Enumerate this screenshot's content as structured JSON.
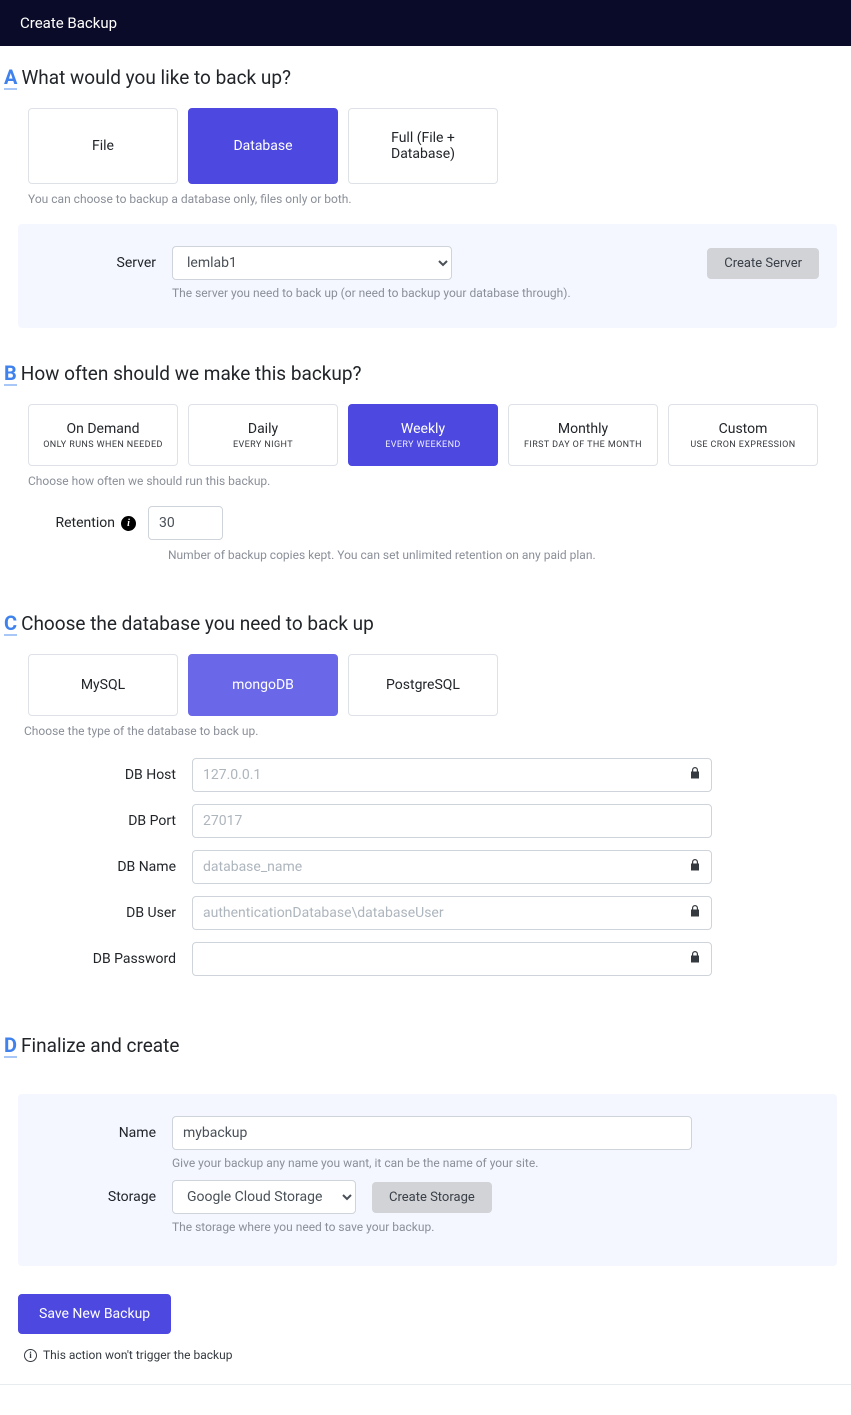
{
  "header": {
    "title": "Create Backup"
  },
  "sectionA": {
    "letter": "A",
    "title": "What would you like to back up?",
    "options": [
      {
        "label": "File"
      },
      {
        "label": "Database"
      },
      {
        "label": "Full (File + Database)"
      }
    ],
    "helper": "You can choose to backup a database only, files only or both.",
    "server": {
      "label": "Server",
      "value": "lemlab1",
      "button": "Create Server",
      "helper": "The server you need to back up (or need to backup your database through)."
    }
  },
  "sectionB": {
    "letter": "B",
    "title": "How often should we make this backup?",
    "options": [
      {
        "title": "On Demand",
        "sub": "ONLY RUNS WHEN NEEDED"
      },
      {
        "title": "Daily",
        "sub": "EVERY NIGHT"
      },
      {
        "title": "Weekly",
        "sub": "EVERY WEEKEND"
      },
      {
        "title": "Monthly",
        "sub": "FIRST DAY OF THE MONTH"
      },
      {
        "title": "Custom",
        "sub": "USE CRON EXPRESSION"
      }
    ],
    "helper": "Choose how often we should run this backup.",
    "retention": {
      "label": "Retention",
      "value": "30",
      "helper": "Number of backup copies kept. You can set unlimited retention on any paid plan."
    }
  },
  "sectionC": {
    "letter": "C",
    "title": "Choose the database you need to back up",
    "options": [
      {
        "label": "MySQL"
      },
      {
        "label": "mongoDB"
      },
      {
        "label": "PostgreSQL"
      }
    ],
    "helper": "Choose the type of the database to back up.",
    "fields": {
      "host": {
        "label": "DB Host",
        "placeholder": "127.0.0.1",
        "lock": true
      },
      "port": {
        "label": "DB Port",
        "placeholder": "27017",
        "lock": false
      },
      "name": {
        "label": "DB Name",
        "placeholder": "database_name",
        "lock": true
      },
      "user": {
        "label": "DB User",
        "placeholder": "authenticationDatabase\\databaseUser",
        "lock": true
      },
      "pass": {
        "label": "DB Password",
        "placeholder": "",
        "lock": true
      }
    }
  },
  "sectionD": {
    "letter": "D",
    "title": "Finalize and create",
    "name": {
      "label": "Name",
      "value": "mybackup",
      "helper": "Give your backup any name you want, it can be the name of your site."
    },
    "storage": {
      "label": "Storage",
      "value": "Google Cloud Storage",
      "button": "Create Storage",
      "helper": "The storage where you need to save your backup."
    }
  },
  "save": {
    "button": "Save New Backup",
    "note": "This action won't trigger the backup"
  }
}
